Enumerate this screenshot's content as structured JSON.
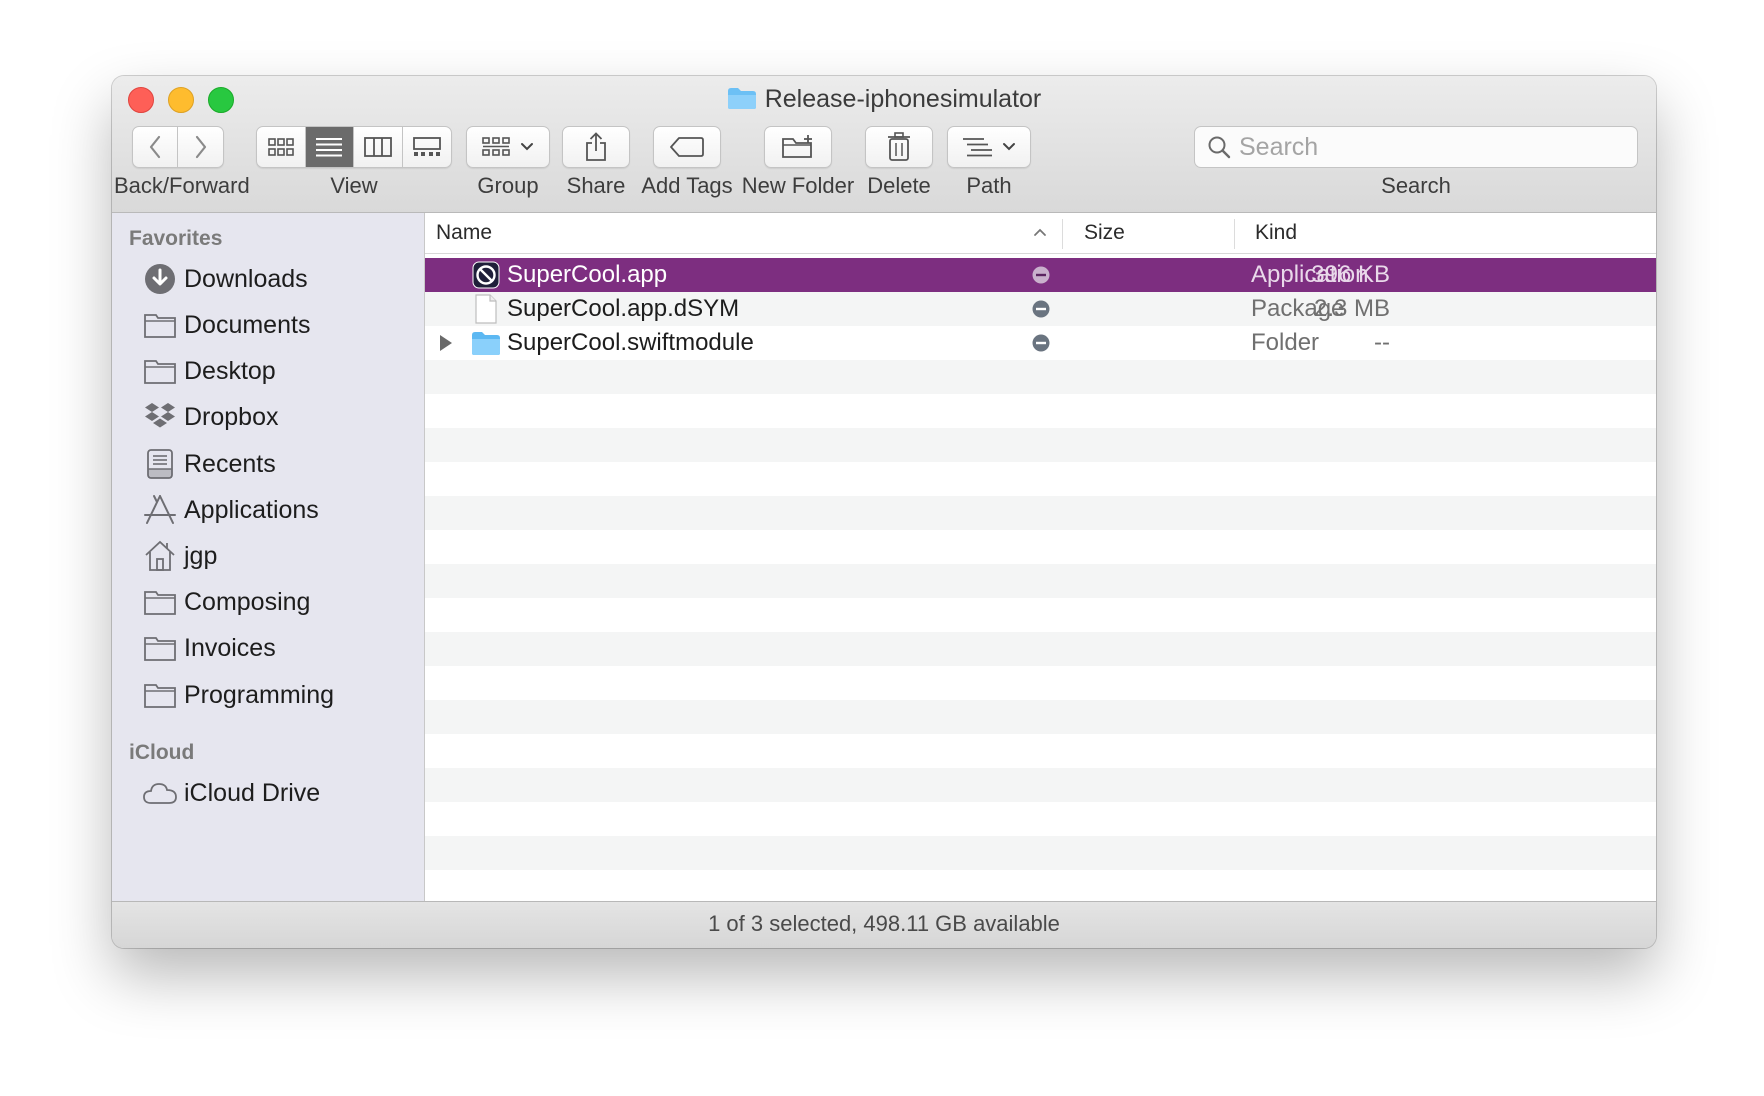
{
  "window": {
    "title": "Release-iphonesimulator"
  },
  "toolbar": {
    "back_forward_label": "Back/Forward",
    "view_label": "View",
    "group_label": "Group",
    "share_label": "Share",
    "add_tags_label": "Add Tags",
    "new_folder_label": "New Folder",
    "delete_label": "Delete",
    "path_label": "Path",
    "search_label": "Search",
    "search_placeholder": "Search",
    "active_view": "list"
  },
  "sidebar": {
    "favorites_header": "Favorites",
    "favorites": [
      {
        "label": "Downloads",
        "icon": "downloads-icon"
      },
      {
        "label": "Documents",
        "icon": "folder-icon"
      },
      {
        "label": "Desktop",
        "icon": "folder-icon"
      },
      {
        "label": "Dropbox",
        "icon": "dropbox-icon"
      },
      {
        "label": "Recents",
        "icon": "recents-icon"
      },
      {
        "label": "Applications",
        "icon": "applications-icon"
      },
      {
        "label": "jgp",
        "icon": "home-icon"
      },
      {
        "label": "Composing",
        "icon": "folder-icon"
      },
      {
        "label": "Invoices",
        "icon": "folder-icon"
      },
      {
        "label": "Programming",
        "icon": "folder-icon"
      }
    ],
    "icloud_header": "iCloud",
    "icloud": [
      {
        "label": "iCloud Drive",
        "icon": "cloud-icon"
      }
    ]
  },
  "columns": {
    "name": "Name",
    "size": "Size",
    "kind": "Kind",
    "sort_indicator": "ascending"
  },
  "files": [
    {
      "name": "SuperCool.app",
      "size": "396 KB",
      "kind": "Application",
      "icon": "app-prohibited-icon",
      "selected": true
    },
    {
      "name": "SuperCool.app.dSYM",
      "size": "2.3 MB",
      "kind": "Package",
      "icon": "document-icon",
      "selected": false
    },
    {
      "name": "SuperCool.swiftmodule",
      "size": "--",
      "kind": "Folder",
      "icon": "folder-blue-icon",
      "selected": false
    }
  ],
  "status": {
    "text": "1 of 3 selected, 498.11 GB available"
  },
  "colors": {
    "selection": "#7d2e80",
    "close": "#fe5f57",
    "minimize": "#febc2e",
    "zoom": "#28c840",
    "folder_blue": "#5cb8f2"
  }
}
